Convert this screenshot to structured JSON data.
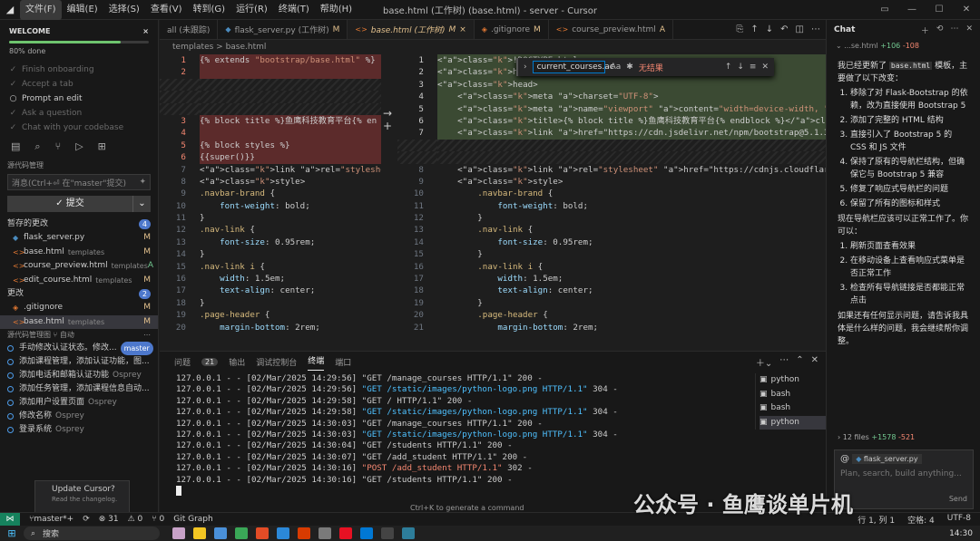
{
  "window": {
    "title": "base.html (工作树) (base.html) - server - Cursor"
  },
  "menu": [
    "文件(F)",
    "编辑(E)",
    "选择(S)",
    "查看(V)",
    "转到(G)",
    "运行(R)",
    "终端(T)",
    "帮助(H)"
  ],
  "welcome": {
    "title": "WELCOME",
    "close": "×",
    "progress_label": "80% done",
    "progress": 0.8,
    "items": [
      {
        "label": "Finish onboarding",
        "done": true
      },
      {
        "label": "Accept a tab",
        "done": true
      },
      {
        "label": "Prompt an edit",
        "done": false
      },
      {
        "label": "Ask a question",
        "done": true
      },
      {
        "label": "Chat with your codebase",
        "done": true
      }
    ]
  },
  "scm": {
    "title": "源代码管理",
    "commit_placeholder": "消息(Ctrl+⏎ 在\"master\"提交)",
    "commit_button": "✓ 提交",
    "staged": {
      "label": "暂存的更改",
      "count": "4",
      "files": [
        {
          "name": "flask_server.py",
          "dir": "",
          "status": "M",
          "type": "py"
        },
        {
          "name": "base.html",
          "dir": "templates",
          "status": "M",
          "type": "html"
        },
        {
          "name": "course_preview.html",
          "dir": "templates",
          "status": "A",
          "type": "html"
        },
        {
          "name": "edit_course.html",
          "dir": "templates",
          "status": "M",
          "type": "html"
        }
      ]
    },
    "changes": {
      "label": "更改",
      "count": "2",
      "files": [
        {
          "name": ".gitignore",
          "dir": "",
          "status": "M",
          "type": "git"
        },
        {
          "name": "base.html",
          "dir": "templates",
          "status": "M",
          "type": "html"
        }
      ]
    }
  },
  "graph": {
    "title": "源代码管理图",
    "auto": "自动",
    "commits": [
      {
        "msg": "手动修改认证状态。修改...",
        "author": "",
        "badge": "master"
      },
      {
        "msg": "添加课程管理，添加认证功能，图...",
        "author": ""
      },
      {
        "msg": "添加电话和邮箱认证功能",
        "author": "Osprey"
      },
      {
        "msg": "添加任务管理，添加课程信息自动...",
        "author": ""
      },
      {
        "msg": "添加用户设置页面",
        "author": "Osprey"
      },
      {
        "msg": "修改名称",
        "author": "Osprey"
      },
      {
        "msg": "登录系统",
        "author": "Osprey"
      }
    ]
  },
  "notification": {
    "title": "Update Cursor?",
    "sub": "Read the changelog."
  },
  "tabs": [
    {
      "label": "all (未跟踪)",
      "state": "",
      "type": "none"
    },
    {
      "label": "flask_server.py (工作树)",
      "state": "M",
      "type": "py"
    },
    {
      "label": "base.html (工作树)",
      "state": "M",
      "type": "html",
      "active": true
    },
    {
      "label": ".gitignore",
      "state": "M",
      "type": "git"
    },
    {
      "label": "course_preview.html",
      "state": "A",
      "type": "html"
    }
  ],
  "breadcrumb": "templates > base.html",
  "find": {
    "value": "current_courses.ac",
    "case": "Aa",
    "result": "无结果"
  },
  "diff": {
    "left": [
      {
        "n": "1",
        "t": "{% extends \"bootstrap/base.html\" %}",
        "c": "del"
      },
      {
        "n": "2",
        "t": "",
        "c": "del"
      },
      {
        "n": "",
        "t": "",
        "c": "hatch"
      },
      {
        "n": "",
        "t": "",
        "c": "hatch"
      },
      {
        "n": "",
        "t": "",
        "c": "hatch"
      },
      {
        "n": "3",
        "t": "{% block title %}鱼鹰科技教育平台{% en",
        "c": "del"
      },
      {
        "n": "4",
        "t": "",
        "c": "del"
      },
      {
        "n": "5",
        "t": "{% block styles %}",
        "c": "del"
      },
      {
        "n": "6",
        "t": "{{super()}}",
        "c": "del"
      },
      {
        "n": "7",
        "t": "<link rel=\"stylesheet\" href=\"https:/",
        "c": ""
      },
      {
        "n": "8",
        "t": "<style>",
        "c": ""
      },
      {
        "n": "9",
        "t": ".navbar-brand {",
        "c": ""
      },
      {
        "n": "10",
        "t": "    font-weight: bold;",
        "c": ""
      },
      {
        "n": "11",
        "t": "}",
        "c": ""
      },
      {
        "n": "12",
        "t": ".nav-link {",
        "c": ""
      },
      {
        "n": "13",
        "t": "    font-size: 0.95rem;",
        "c": ""
      },
      {
        "n": "14",
        "t": "}",
        "c": ""
      },
      {
        "n": "15",
        "t": ".nav-link i {",
        "c": ""
      },
      {
        "n": "16",
        "t": "    width: 1.5em;",
        "c": ""
      },
      {
        "n": "17",
        "t": "    text-align: center;",
        "c": ""
      },
      {
        "n": "18",
        "t": "}",
        "c": ""
      },
      {
        "n": "19",
        "t": ".page-header {",
        "c": ""
      },
      {
        "n": "20",
        "t": "    margin-bottom: 2rem;",
        "c": ""
      }
    ],
    "right": [
      {
        "n": "1",
        "t": "<!DOCTYPE html>",
        "c": "add"
      },
      {
        "n": "2",
        "t": "<html lang=\"zh\">",
        "c": "add"
      },
      {
        "n": "3",
        "t": "<head>",
        "c": "add"
      },
      {
        "n": "4",
        "t": "    <meta charset=\"UTF-8\">",
        "c": "add"
      },
      {
        "n": "5",
        "t": "    <meta name=\"viewport\" content=\"width=device-width, initial-scale=1\">",
        "c": "add"
      },
      {
        "n": "6",
        "t": "    <title>{% block title %}鱼鹰科技教育平台{% endblock %}</title>",
        "c": "add"
      },
      {
        "n": "7",
        "t": "    <link href=\"https://cdn.jsdelivr.net/npm/bootstrap@5.1.3/dist/css/boot",
        "c": "add"
      },
      {
        "n": "",
        "t": "",
        "c": "hatch"
      },
      {
        "n": "",
        "t": "",
        "c": "hatch"
      },
      {
        "n": "8",
        "t": "    <link rel=\"stylesheet\" href=\"https://cdnjs.cloudflare.com/ajax/libs/fo",
        "c": ""
      },
      {
        "n": "9",
        "t": "    <style>",
        "c": ""
      },
      {
        "n": "10",
        "t": "        .navbar-brand {",
        "c": ""
      },
      {
        "n": "11",
        "t": "            font-weight: bold;",
        "c": ""
      },
      {
        "n": "12",
        "t": "        }",
        "c": ""
      },
      {
        "n": "13",
        "t": "        .nav-link {",
        "c": ""
      },
      {
        "n": "14",
        "t": "            font-size: 0.95rem;",
        "c": ""
      },
      {
        "n": "15",
        "t": "        }",
        "c": ""
      },
      {
        "n": "16",
        "t": "        .nav-link i {",
        "c": ""
      },
      {
        "n": "17",
        "t": "            width: 1.5em;",
        "c": ""
      },
      {
        "n": "18",
        "t": "            text-align: center;",
        "c": ""
      },
      {
        "n": "19",
        "t": "        }",
        "c": ""
      },
      {
        "n": "20",
        "t": "        .page-header {",
        "c": ""
      },
      {
        "n": "21",
        "t": "            margin-bottom: 2rem;",
        "c": ""
      }
    ]
  },
  "panel": {
    "tabs": [
      "问题",
      "输出",
      "调试控制台",
      "终端",
      "端口"
    ],
    "problems_count": "21",
    "active": "终端",
    "hint": "Ctrl+K to generate a command",
    "terminal": [
      {
        "pre": "127.0.0.1 - - [02/Mar/2025 14:29:56] \"GET /manage_courses HTTP/1.1\" 200 -",
        "hl": ""
      },
      {
        "pre": "127.0.0.1 - - [02/Mar/2025 14:29:56] \"GET /static/images/python-logo.png HTTP/1.1\" 304 -",
        "hl": "g"
      },
      {
        "pre": "127.0.0.1 - - [02/Mar/2025 14:29:58] \"GET / HTTP/1.1\" 200 -",
        "hl": ""
      },
      {
        "pre": "127.0.0.1 - - [02/Mar/2025 14:29:58] \"GET /static/images/python-logo.png HTTP/1.1\" 304 -",
        "hl": "g"
      },
      {
        "pre": "127.0.0.1 - - [02/Mar/2025 14:30:03] \"GET /manage_courses HTTP/1.1\" 200 -",
        "hl": ""
      },
      {
        "pre": "127.0.0.1 - - [02/Mar/2025 14:30:03] \"GET /static/images/python-logo.png HTTP/1.1\" 304 -",
        "hl": "g"
      },
      {
        "pre": "127.0.0.1 - - [02/Mar/2025 14:30:04] \"GET /students HTTP/1.1\" 200 -",
        "hl": ""
      },
      {
        "pre": "127.0.0.1 - - [02/Mar/2025 14:30:07] \"GET /add_student HTTP/1.1\" 200 -",
        "hl": ""
      },
      {
        "pre": "127.0.0.1 - - [02/Mar/2025 14:30:16] \"POST /add_student HTTP/1.1\" 302 -",
        "hl": "r"
      },
      {
        "pre": "127.0.0.1 - - [02/Mar/2025 14:30:16] \"GET /students HTTP/1.1\" 200 -",
        "hl": ""
      }
    ],
    "terminals": [
      "python",
      "bash",
      "bash",
      "python"
    ]
  },
  "chat": {
    "title": "Chat",
    "file_summary": "...se.html",
    "plus": "+106",
    "minus": "-108",
    "intro_pre": "我已经更新了 ",
    "intro_code": "base.html",
    "intro_post": " 模板，主要做了以下改变：",
    "changes": [
      "移除了对 Flask-Bootstrap 的依赖，改为直接使用 Bootstrap 5",
      "添加了完整的 HTML 结构",
      "直接引入了 Bootstrap 5 的 CSS 和 JS 文件",
      "保持了原有的导航栏结构，但确保它与 Bootstrap 5 兼容",
      "修复了响应式导航栏的问题",
      "保留了所有的图标和样式"
    ],
    "mid": "现在导航栏应该可以正常工作了。你可以：",
    "steps": [
      "刷新页面查看效果",
      "在移动设备上查看响应式菜单是否正常工作",
      "检查所有导航链接是否都能正常点击"
    ],
    "outro": "如果还有任何显示问题，请告诉我具体是什么样的问题，我会继续帮你调整。",
    "files_summary": "12 files",
    "files_plus": "+1578",
    "files_minus": "-521",
    "input_chip": "flask_server.py",
    "input_placeholder": "Plan, search, build anything...",
    "send": "Send"
  },
  "status": {
    "branch": "master*+",
    "sync": "⟳",
    "errors": "⊗ 31",
    "warnings": "⚠ 0",
    "ports": "⑂ 0",
    "graph": "Git Graph",
    "pos": "行 1, 列 1",
    "spaces": "空格: 4",
    "enc": "UTF-8"
  },
  "taskbar": {
    "search": "搜索",
    "time": "14:30"
  },
  "watermark": "公众号 · 鱼鹰谈单片机"
}
